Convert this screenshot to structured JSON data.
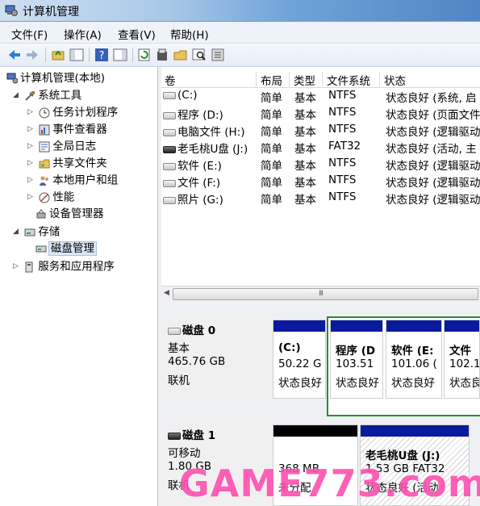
{
  "window": {
    "title": "计算机管理"
  },
  "menu": {
    "items": [
      "文件(F)",
      "操作(A)",
      "查看(V)",
      "帮助(H)"
    ]
  },
  "tree": {
    "root": "计算机管理(本地)",
    "system_tools": "系统工具",
    "task_scheduler": "任务计划程序",
    "event_viewer": "事件查看器",
    "global_log": "全局日志",
    "shared_folders": "共享文件夹",
    "local_users": "本地用户和组",
    "performance": "性能",
    "device_manager": "设备管理器",
    "storage": "存储",
    "disk_management": "磁盘管理",
    "services_apps": "服务和应用程序"
  },
  "volumes": {
    "columns": [
      "卷",
      "布局",
      "类型",
      "文件系统",
      "状态"
    ],
    "rows": [
      {
        "name": "(C:)",
        "layout": "简单",
        "type": "基本",
        "fs": "NTFS",
        "status": "状态良好 (系统, 启"
      },
      {
        "name": "程序 (D:)",
        "layout": "简单",
        "type": "基本",
        "fs": "NTFS",
        "status": "状态良好 (页面文件"
      },
      {
        "name": "电脑文件 (H:)",
        "layout": "简单",
        "type": "基本",
        "fs": "NTFS",
        "status": "状态良好 (逻辑驱动"
      },
      {
        "name": "老毛桃U盘 (J:)",
        "layout": "简单",
        "type": "基本",
        "fs": "FAT32",
        "status": "状态良好 (活动, 主"
      },
      {
        "name": "软件 (E:)",
        "layout": "简单",
        "type": "基本",
        "fs": "NTFS",
        "status": "状态良好 (逻辑驱动"
      },
      {
        "name": "文件 (F:)",
        "layout": "简单",
        "type": "基本",
        "fs": "NTFS",
        "status": "状态良好 (逻辑驱动"
      },
      {
        "name": "照片 (G:)",
        "layout": "简单",
        "type": "基本",
        "fs": "NTFS",
        "status": "状态良好 (逻辑驱动"
      }
    ],
    "scroll_grip": "III"
  },
  "disks": {
    "disk0": {
      "name": "磁盘 0",
      "type": "基本",
      "size": "465.76 GB",
      "state": "联机",
      "parts": [
        {
          "name": "(C:)",
          "size": "50.22 G",
          "status": "状态良好"
        },
        {
          "name": "程序 (D",
          "size": "103.51",
          "status": "状态良好"
        },
        {
          "name": "软件 (E:",
          "size": "101.06 (",
          "status": "状态良好"
        },
        {
          "name": "文件",
          "size": "102.1",
          "status": "状态良"
        }
      ]
    },
    "disk1": {
      "name": "磁盘 1",
      "type": "可移动",
      "size": "1.80 GB",
      "state": "联机",
      "parts": [
        {
          "name": "",
          "size": "368 MB",
          "status": "未分配"
        },
        {
          "name": "老毛桃U盘 (J:)",
          "size": "1.53 GB FAT32",
          "status": "状态良好 (活动"
        }
      ]
    }
  },
  "watermark": "GAME773.com"
}
